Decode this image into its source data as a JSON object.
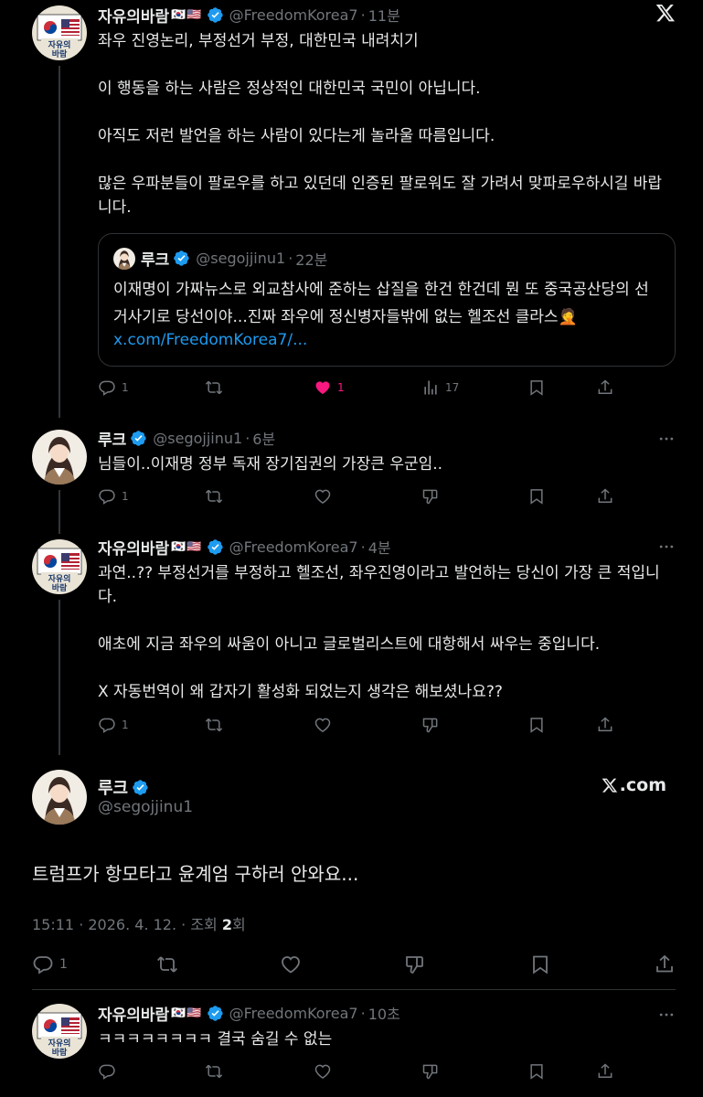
{
  "tweets": [
    {
      "name": "자유의바람",
      "flags": "🇰🇷🇺🇸",
      "handle": "@FreedomKorea7",
      "time": "11분",
      "text": "좌우 진영논리, 부정선거 부정, 대한민국 내려치기\n\n이 행동을 하는 사람은 정상적인 대한민국 국민이 아닙니다.\n\n아직도 저런 발언을 하는 사람이 있다는게 놀라울 따름입니다.\n\n많은 우파분들이 팔로우를 하고 있던데 인증된 팔로워도 잘 가려서 맞파로우하시길 바랍니다.",
      "quote": {
        "name": "루크",
        "handle": "@segojjinu1",
        "time": "22분",
        "text": "이재명이 가짜뉴스로 외교참사에 준하는 삽질을 한건 한건데 뭔 또 중국공산당의 선거사기로 당선이야...진짜 좌우에 정신병자들밖에 없는 헬조선 클라스🤦",
        "link": "x.com/FreedomKorea7/..."
      },
      "replies": "1",
      "likes": "1",
      "views": "17"
    },
    {
      "name": "루크",
      "handle": "@segojjinu1",
      "time": "6분",
      "text": "님들이..이재명 정부 독재 장기집권의 가장큰 우군임..",
      "replies": "1"
    },
    {
      "name": "자유의바람",
      "flags": "🇰🇷🇺🇸",
      "handle": "@FreedomKorea7",
      "time": "4분",
      "text": "과연..?? 부정선거를 부정하고 헬조선, 좌우진영이라고 발언하는 당신이 가장 큰 적입니다.\n\n애초에 지금 좌우의 싸움이 아니고 글로벌리스트에 대항해서 싸우는 중입니다.\n\nX 자동번역이 왜 갑자기 활성화 되었는지 생각은 해보셨나요??",
      "replies": "1"
    }
  ],
  "main": {
    "name": "루크",
    "handle": "@segojjinu1",
    "xcom": ".com",
    "text": "트럼프가 항모타고 윤계엄 구하러 안와요...",
    "meta_prefix": "15:11 · 2026. 4. 12. · 조회 ",
    "views": "2",
    "meta_suffix": "회",
    "replies": "1"
  },
  "last": {
    "name": "자유의바람",
    "flags": "🇰🇷🇺🇸",
    "handle": "@FreedomKorea7",
    "time": "10초",
    "text": "ㅋㅋㅋㅋㅋㅋㅋㅋ 결국 숨길 수 없는"
  },
  "colors": {
    "background": "#000000",
    "text": "#e7e9ea",
    "muted": "#71767b",
    "link": "#1d9bf0",
    "like": "#f91880",
    "verified": "#1d9bf0",
    "border": "#2f3336"
  },
  "icons": [
    "x-logo-icon",
    "verified-badge-icon",
    "reply-icon",
    "retweet-icon",
    "like-icon",
    "views-icon",
    "dislike-icon",
    "bookmark-icon",
    "share-icon",
    "more-icon"
  ]
}
